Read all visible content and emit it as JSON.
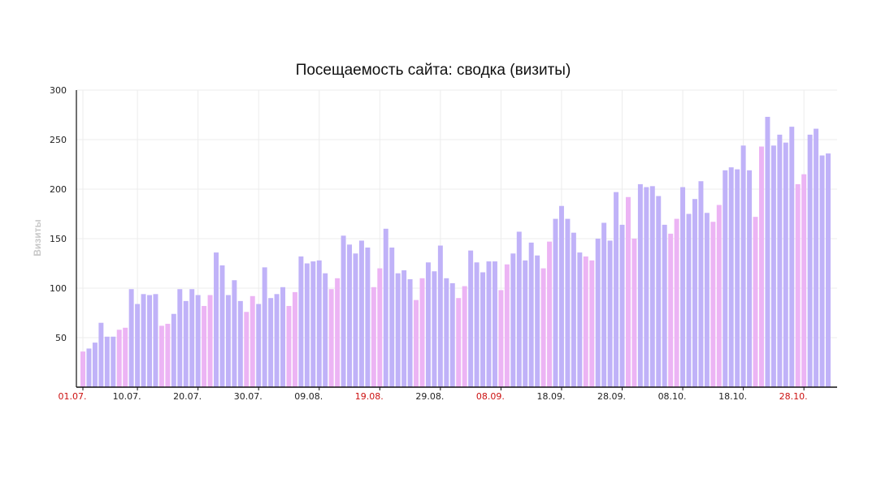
{
  "chart_data": {
    "type": "bar",
    "title": "Посещаемость сайта: сводка (визиты)",
    "xlabel": "",
    "ylabel": "Визиты",
    "ylim": [
      0,
      300
    ],
    "yticks": [
      50,
      100,
      150,
      200,
      250,
      300
    ],
    "grid": true,
    "legend": "none",
    "x_tick_labels": [
      {
        "label": "01.07.",
        "index": 0,
        "weekend": true
      },
      {
        "label": "10.07.",
        "index": 9,
        "weekend": false
      },
      {
        "label": "20.07.",
        "index": 19,
        "weekend": false
      },
      {
        "label": "30.07.",
        "index": 29,
        "weekend": false
      },
      {
        "label": "09.08.",
        "index": 39,
        "weekend": false
      },
      {
        "label": "19.08.",
        "index": 49,
        "weekend": true
      },
      {
        "label": "29.08.",
        "index": 59,
        "weekend": false
      },
      {
        "label": "08.09.",
        "index": 69,
        "weekend": true
      },
      {
        "label": "18.09.",
        "index": 79,
        "weekend": false
      },
      {
        "label": "28.09.",
        "index": 89,
        "weekend": false
      },
      {
        "label": "08.10.",
        "index": 99,
        "weekend": false
      },
      {
        "label": "18.10.",
        "index": 109,
        "weekend": false
      },
      {
        "label": "28.10.",
        "index": 119,
        "weekend": true
      }
    ],
    "start_date": "01.07.",
    "values": [
      36,
      39,
      45,
      65,
      51,
      51,
      58,
      60,
      99,
      84,
      94,
      93,
      94,
      62,
      64,
      74,
      99,
      87,
      99,
      93,
      82,
      93,
      136,
      123,
      93,
      108,
      87,
      76,
      92,
      84,
      121,
      90,
      94,
      101,
      82,
      96,
      132,
      125,
      127,
      128,
      115,
      99,
      110,
      153,
      144,
      135,
      148,
      141,
      101,
      120,
      160,
      141,
      115,
      118,
      109,
      88,
      110,
      126,
      117,
      143,
      110,
      105,
      90,
      102,
      138,
      126,
      116,
      127,
      127,
      98,
      124,
      135,
      157,
      128,
      146,
      133,
      120,
      147,
      170,
      183,
      170,
      156,
      136,
      132,
      128,
      150,
      166,
      148,
      197,
      164,
      192,
      150,
      205,
      202,
      203,
      193,
      164,
      155,
      170,
      202,
      175,
      190,
      208,
      176,
      167,
      184,
      219,
      222,
      220,
      244,
      219,
      172,
      243,
      273,
      244,
      255,
      247,
      263,
      205,
      215,
      255,
      261,
      234,
      236
    ],
    "weekend_flags": [
      true,
      false,
      false,
      false,
      false,
      false,
      true,
      true,
      false,
      false,
      false,
      false,
      false,
      true,
      true,
      false,
      false,
      false,
      false,
      false,
      true,
      true,
      false,
      false,
      false,
      false,
      false,
      true,
      true,
      false,
      false,
      false,
      false,
      false,
      true,
      true,
      false,
      false,
      false,
      false,
      false,
      true,
      true,
      false,
      false,
      false,
      false,
      false,
      true,
      true,
      false,
      false,
      false,
      false,
      false,
      true,
      true,
      false,
      false,
      false,
      false,
      false,
      true,
      true,
      false,
      false,
      false,
      false,
      false,
      true,
      true,
      false,
      false,
      false,
      false,
      false,
      true,
      true,
      false,
      false,
      false,
      false,
      false,
      true,
      true,
      false,
      false,
      false,
      false,
      false,
      true,
      true,
      false,
      false,
      false,
      false,
      false,
      true,
      true,
      false,
      false,
      false,
      false,
      false,
      true,
      true,
      false,
      false,
      false,
      false,
      false,
      true,
      true,
      false,
      false,
      false,
      false,
      false,
      true,
      true,
      false,
      false,
      false,
      false
    ],
    "colors": {
      "weekday": "#c0b2f8",
      "weekend": "#ecb4f4",
      "grid": "#ececec",
      "axis": "#111111",
      "tick_label": "#222222",
      "tick_label_weekend": "#cc1111",
      "ylabel": "#c8c8c8"
    }
  }
}
